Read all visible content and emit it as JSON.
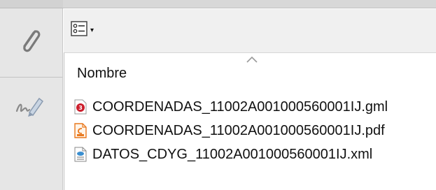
{
  "toolbar": {
    "options_icon": "list-options-icon",
    "options_caret": "▾"
  },
  "rail": {
    "attach_icon": "paperclip-icon",
    "sign_icon": "sign-pen-icon"
  },
  "list": {
    "column_header": "Nombre",
    "sort_indicator": "ascending",
    "files": [
      {
        "name": "COORDENADAS_11002A001000560001IJ.gml",
        "icon": "gml-file-icon",
        "color": "#cc1f2d"
      },
      {
        "name": "COORDENADAS_11002A001000560001IJ.pdf",
        "icon": "pdf-file-icon",
        "color": "#e8781e"
      },
      {
        "name": "DATOS_CDYG_11002A001000560001IJ.xml",
        "icon": "xml-file-icon",
        "color": "#3b8fd0"
      }
    ]
  }
}
